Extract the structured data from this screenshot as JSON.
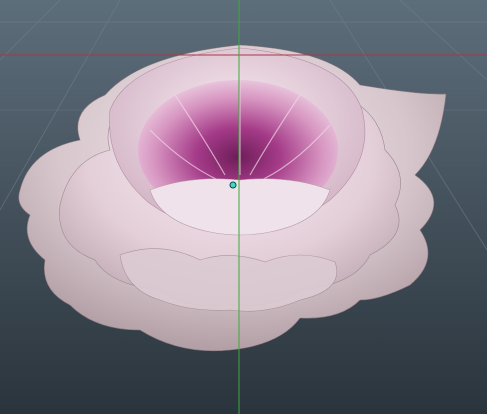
{
  "viewport": {
    "background_top": "#5d6e7b",
    "background_bottom": "#2a343c",
    "grid_color": "#6f808c",
    "horizontal_axis_color": "#a8384a",
    "vertical_axis_color": "#3da83c",
    "pivot_color": "#3fd7c8",
    "model_subject": "flower"
  },
  "flower_palette": {
    "outer_petal": "#b8a3a8",
    "outer_petal_light": "#e8dde0",
    "inner_petal": "#e7c3da",
    "center": "#7a2364",
    "center_mid": "#b04b92"
  }
}
